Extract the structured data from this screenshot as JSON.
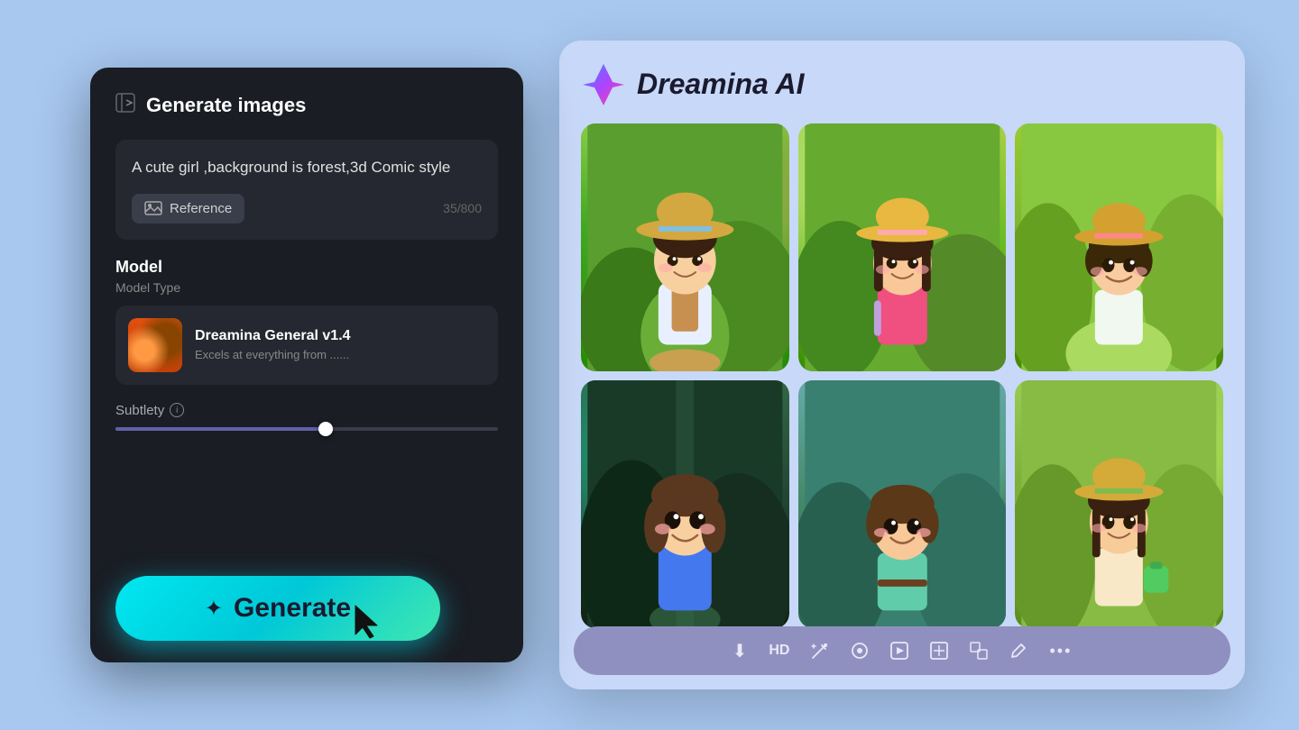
{
  "app": {
    "name": "Dreamina AI",
    "background_color": "#a8c8f0"
  },
  "left_panel": {
    "header": {
      "icon": "→|",
      "title": "Generate images"
    },
    "prompt": {
      "text": "A cute girl ,background is forest,3d Comic style",
      "char_count": "35/800"
    },
    "reference_button": {
      "label": "Reference"
    },
    "model": {
      "section_label": "Model",
      "type_label": "Model Type",
      "name": "Dreamina General v1.4",
      "description": "Excels at everything from ......"
    },
    "subtlety": {
      "label": "Subtlety",
      "value": 55
    },
    "generate_button": {
      "label": "Generate",
      "icon": "✦"
    }
  },
  "right_panel": {
    "brand": {
      "title": "Dreamina AI",
      "logo_icon": "✦"
    },
    "images": [
      {
        "id": 1,
        "alt": "Cute girl with straw hat in forest, 3D comic style, bright colors"
      },
      {
        "id": 2,
        "alt": "Cute girl with straw hat, pink shirt, forest background"
      },
      {
        "id": 3,
        "alt": "Cute girl with hat smiling in green forest"
      },
      {
        "id": 4,
        "alt": "Cute girl with brown hair in dark forest, blue outfit"
      },
      {
        "id": 5,
        "alt": "Cute girl with short hair in forest, teal top"
      },
      {
        "id": 6,
        "alt": "Cute girl with straw hat and braids, green bag"
      }
    ],
    "toolbar": {
      "icons": [
        {
          "name": "download-icon",
          "symbol": "⬇",
          "label": "Download"
        },
        {
          "name": "hd-icon",
          "symbol": "HD",
          "label": "HD Quality"
        },
        {
          "name": "magic-wand-icon",
          "symbol": "✏",
          "label": "Magic Wand"
        },
        {
          "name": "erase-icon",
          "symbol": "⊙",
          "label": "Erase"
        },
        {
          "name": "play-icon",
          "symbol": "▶",
          "label": "Play"
        },
        {
          "name": "expand-icon",
          "symbol": "⛶",
          "label": "Expand"
        },
        {
          "name": "resize-icon",
          "symbol": "⊞",
          "label": "Resize"
        },
        {
          "name": "edit-icon",
          "symbol": "✒",
          "label": "Edit"
        },
        {
          "name": "more-icon",
          "symbol": "•••",
          "label": "More options"
        }
      ]
    }
  },
  "connector": {
    "icon": "»"
  }
}
